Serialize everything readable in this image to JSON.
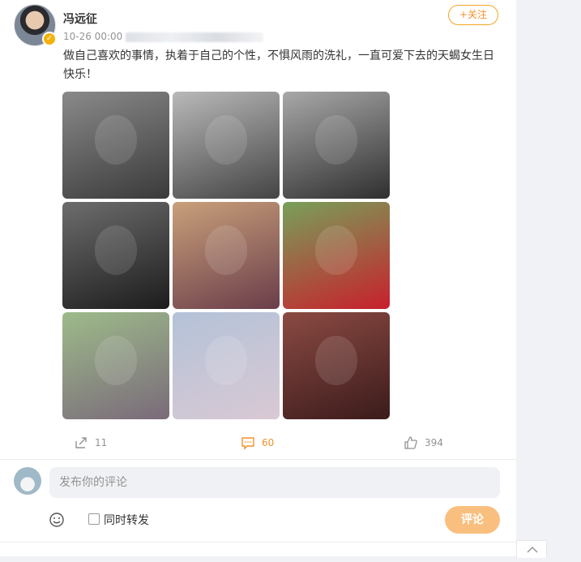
{
  "post": {
    "author": "冯远征",
    "time": "10-26 00:00",
    "follow_label": "+关注",
    "text": "做自己喜欢的事情，执着于自己的个性，不惧风雨的洗礼，一直可爱下去的天蝎女生日快乐！",
    "photos": [
      {
        "name": "bw-child-dancing",
        "colors": [
          "#3a3a3a",
          "#8a8a8a"
        ]
      },
      {
        "name": "bw-child-smiling",
        "colors": [
          "#444",
          "#b9b9b9"
        ]
      },
      {
        "name": "bw-girl-cap",
        "colors": [
          "#2f2f2f",
          "#a8a8a8"
        ]
      },
      {
        "name": "bw-woman-portrait",
        "colors": [
          "#1c1c1c",
          "#6d6d6d"
        ]
      },
      {
        "name": "woman-costume-purple",
        "colors": [
          "#6a3d4a",
          "#c9a07a"
        ]
      },
      {
        "name": "woman-red-dress",
        "colors": [
          "#c8202c",
          "#78a05a"
        ]
      },
      {
        "name": "woman-braid-garden",
        "colors": [
          "#7a6a7a",
          "#9dbb8a"
        ]
      },
      {
        "name": "woman-short-hair-pink",
        "colors": [
          "#d9c9d4",
          "#b4c2d8"
        ]
      },
      {
        "name": "woman-dark-portrait",
        "colors": [
          "#3b1b1b",
          "#8b4a43"
        ]
      }
    ],
    "actions": {
      "repost": "11",
      "comment": "60",
      "like": "394"
    }
  },
  "comment_box": {
    "placeholder": "发布你的评论",
    "repost_label": "同时转发",
    "submit_label": "评论"
  },
  "colors": {
    "accent": "#f5902c",
    "submit_bg": "#f9bf7f",
    "muted": "#939393"
  }
}
